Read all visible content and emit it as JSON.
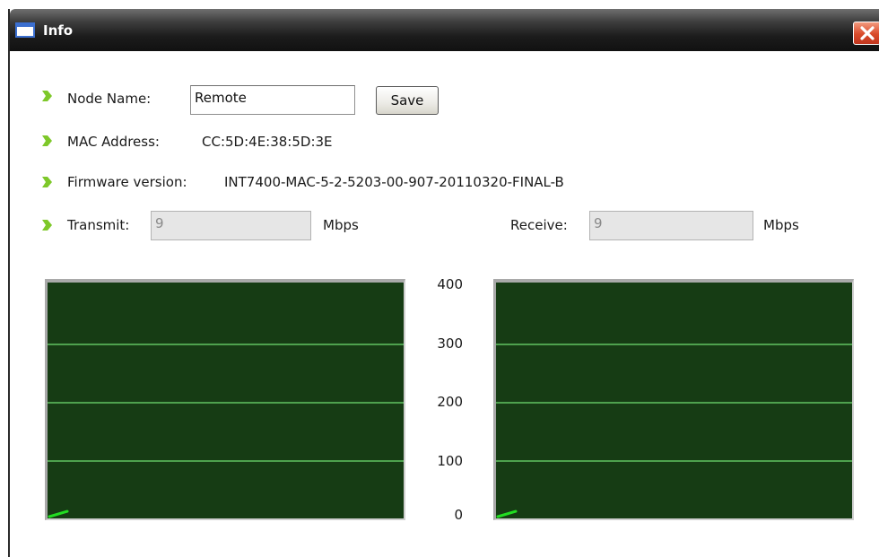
{
  "window": {
    "title": "Info"
  },
  "node_name": {
    "label": "Node Name:",
    "value": "Remote"
  },
  "save_button": {
    "label": "Save"
  },
  "mac": {
    "label": "MAC Address:",
    "value": "CC:5D:4E:38:5D:3E"
  },
  "firmware": {
    "label": "Firmware version:",
    "value": "INT7400-MAC-5-2-5203-00-907-20110320-FINAL-B"
  },
  "transmit": {
    "label": "Transmit:",
    "value": "9",
    "unit": "Mbps"
  },
  "receive": {
    "label": "Receive:",
    "value": "9",
    "unit": "Mbps"
  },
  "graphs": {
    "y_ticks": [
      "400",
      "300",
      "200",
      "100",
      "0"
    ],
    "transmit_rate": 9,
    "receive_rate": 9,
    "line_color": "#22dd22",
    "background_color": "#163c14",
    "grid_color": "#4ea24e"
  },
  "colors": {
    "bullet": "#7ec82a",
    "close_button": "#d94a2a"
  }
}
